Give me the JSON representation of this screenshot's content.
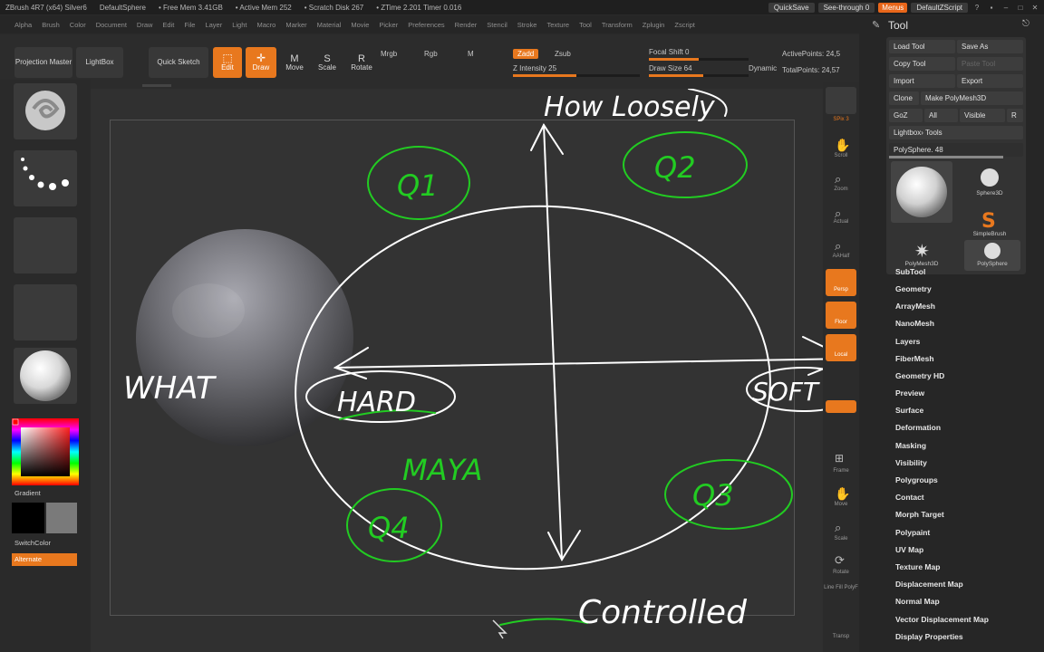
{
  "titlebar": {
    "app": "ZBrush 4R7 (x64) Silver6",
    "doc": "DefaultSphere",
    "free_mem": "• Free Mem 3.41GB",
    "active_mem": "• Active Mem 252",
    "scratch": "• Scratch Disk 267",
    "ztime": "• ZTime 2.201 Timer 0.016",
    "quicksave": "QuickSave",
    "see_through": "See-through 0",
    "menus": "Menus",
    "script": "DefaultZScript"
  },
  "menubar": [
    "Alpha",
    "Brush",
    "Color",
    "Document",
    "Draw",
    "Edit",
    "File",
    "Layer",
    "Light",
    "Macro",
    "Marker",
    "Material",
    "Movie",
    "Picker",
    "Preferences",
    "Render",
    "Stencil",
    "Stroke",
    "Texture",
    "Tool",
    "Transform",
    "Zplugin",
    "Zscript"
  ],
  "shelf": {
    "projection_master": "Projection Master",
    "lightbox": "LightBox",
    "quick_sketch": "Quick Sketch",
    "edit": "Edit",
    "draw": "Draw",
    "move": "Move",
    "scale": "Scale",
    "rotate": "Rotate",
    "mrgb": "Mrgb",
    "rgb": "Rgb",
    "m": "M",
    "zadd": "Zadd",
    "zsub": "Zsub",
    "z_intensity": "Z Intensity 25",
    "focal_shift": "Focal Shift 0",
    "draw_size": "Draw Size 64",
    "dynamic": "Dynamic",
    "active_points": "ActivePoints: 24,5",
    "total_points": "TotalPoints: 24,57"
  },
  "lefttray": {
    "gradient": "Gradient",
    "switchcolor": "SwitchColor",
    "alternate": "Alternate"
  },
  "rightshelf": [
    "SPix 3",
    "Scroll",
    "Zoom",
    "Actual",
    "AAHalf",
    "Persp",
    "Floor",
    "Local",
    "Frame",
    "Move",
    "Scale",
    "Rotate",
    "Line Fill PolyF",
    "Transp"
  ],
  "toolpanel": {
    "title": "Tool",
    "load_tool": "Load Tool",
    "save_as": "Save As",
    "copy_tool": "Copy Tool",
    "paste_tool": "Paste Tool",
    "import": "Import",
    "export": "Export",
    "clone": "Clone",
    "make_polymesh": "Make PolyMesh3D",
    "goz": "GoZ",
    "all": "All",
    "visible": "Visible",
    "r": "R",
    "lightbox_tools": "Lightbox› Tools",
    "polysphere": "PolySphere. 48",
    "thumbs": [
      "Sphere3D",
      "SimpleBrush",
      "PolyMesh3D",
      "PolySphere"
    ],
    "subpalettes": [
      "SubTool",
      "Geometry",
      "ArrayMesh",
      "NanoMesh",
      "Layers",
      "FiberMesh",
      "Geometry HD",
      "Preview",
      "Surface",
      "Deformation",
      "Masking",
      "Visibility",
      "Polygroups",
      "Contact",
      "Morph Target",
      "Polypaint",
      "UV Map",
      "Texture Map",
      "Displacement Map",
      "Normal Map",
      "Vector Displacement Map",
      "Display Properties"
    ]
  },
  "sketch": {
    "top": "How Loosely",
    "bottom": "Controlled",
    "left": "WHAT",
    "hard": "HARD",
    "soft": "SOFT",
    "maya": "MAYA",
    "q1": "Q1",
    "q2": "Q2",
    "q3": "Q3",
    "q4": "Q4"
  },
  "colors": {
    "accent": "#e8781e",
    "sketch_white": "#ffffff",
    "sketch_green": "#22cc22"
  }
}
